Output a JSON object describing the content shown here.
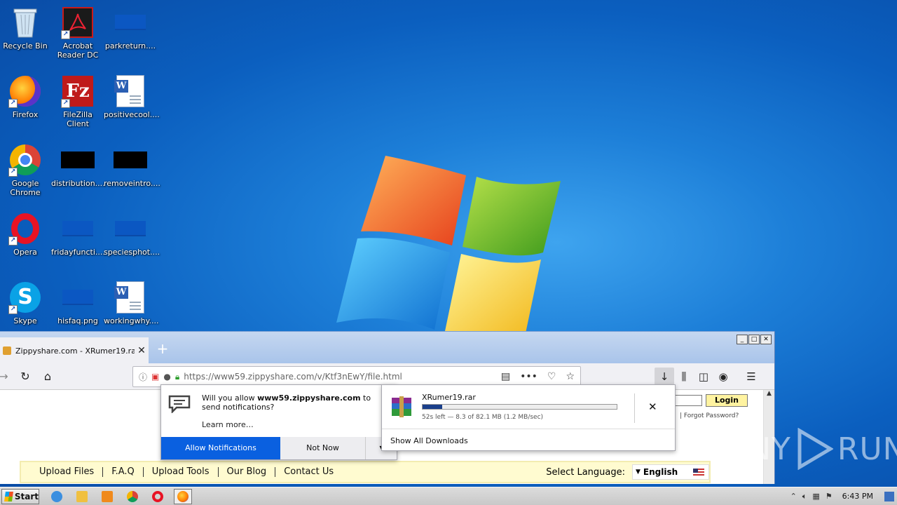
{
  "desktop": {
    "icons": [
      {
        "label": "Recycle Bin",
        "icon": "recycle-bin-icon"
      },
      {
        "label": "Acrobat Reader DC",
        "icon": "acrobat-icon"
      },
      {
        "label": "parkreturn....",
        "icon": "file-icon"
      },
      {
        "label": "Firefox",
        "icon": "firefox-icon"
      },
      {
        "label": "FileZilla Client",
        "icon": "filezilla-icon"
      },
      {
        "label": "positivecool....",
        "icon": "word-doc-icon"
      },
      {
        "label": "Google Chrome",
        "icon": "chrome-icon"
      },
      {
        "label": "distribution....",
        "icon": "file-icon"
      },
      {
        "label": "removeintro....",
        "icon": "file-icon"
      },
      {
        "label": "Opera",
        "icon": "opera-icon"
      },
      {
        "label": "fridayfuncti....",
        "icon": "file-icon"
      },
      {
        "label": "speciesphot....",
        "icon": "file-icon"
      },
      {
        "label": "Skype",
        "icon": "skype-icon"
      },
      {
        "label": "hisfaq.png",
        "icon": "file-icon"
      },
      {
        "label": "workingwhy....",
        "icon": "word-doc-icon"
      }
    ]
  },
  "browser": {
    "tab_title": "Zippyshare.com - XRumer19.rar",
    "url": "https://www59.zippyshare.com/v/Ktf3nEwY/file.html",
    "win_buttons": [
      "_",
      "□",
      "✕"
    ]
  },
  "notification": {
    "prefix": "Will you allow ",
    "site": "www59.zippyshare.com",
    "suffix": " to send notifications?",
    "learn_more": "Learn more…",
    "allow": "Allow Notifications",
    "not_now": "Not Now"
  },
  "downloads": {
    "file_name": "XRumer19.rar",
    "status": "52s left — 8.3 of 82.1 MB (1.2 MB/sec)",
    "progress": 0.101,
    "show_all": "Show All Downloads"
  },
  "site": {
    "login": "Login",
    "forgot": "| Forgot Password?",
    "menu": [
      "Upload Files",
      "F.A.Q",
      "Upload Tools",
      "Our Blog",
      "Contact Us"
    ],
    "select_language": "Select Language:",
    "language": "English"
  },
  "watermark": {
    "left": "ANY",
    "right": "RUN"
  },
  "taskbar": {
    "start": "Start",
    "clock": "6:43 PM"
  },
  "colors": {
    "allow_button": "#0a60e0",
    "progress": "#1a3f8a",
    "menu_strip": "#fffbd0"
  }
}
